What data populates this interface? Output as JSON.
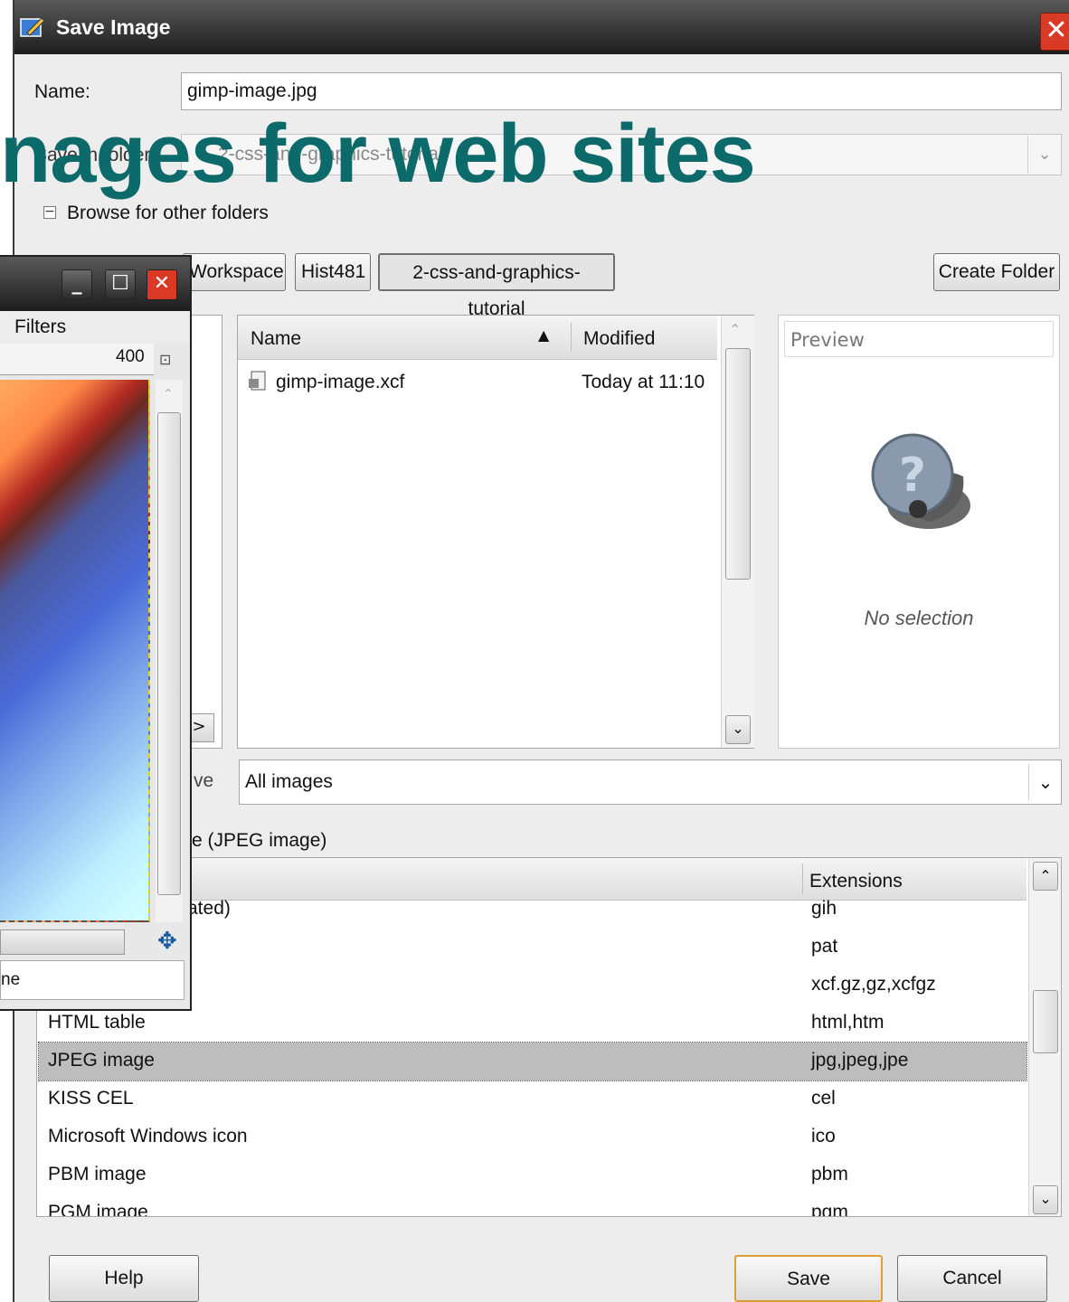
{
  "dialog": {
    "title": "Save Image",
    "close_glyph": "✕",
    "name_label": "Name:",
    "name_value": "gimp-image.jpg",
    "folder_label": "Save in folder:",
    "folder_value": "2-css-and-graphics-tutorial",
    "browse_label": "Browse for other folders",
    "expander_glyph": "−",
    "path_buttons": [
      "Workspace",
      "Hist481",
      "2-css-and-graphics-tutorial"
    ],
    "create_folder": "Create Folder",
    "places": {
      "scroll_right": ">"
    },
    "files": {
      "col_name": "Name",
      "col_modified": "Modified",
      "sort_glyph": "▲",
      "rows": [
        {
          "name": "gimp-image.xcf",
          "modified": "Today at 11:10"
        }
      ]
    },
    "preview": {
      "label": "Preview",
      "no_selection": "No selection"
    },
    "filter_value": "All images",
    "places_remove_fragment": "ve",
    "file_type_label": "e (JPEG image)",
    "types": {
      "col_ext": "Extensions",
      "partial_row_name": "ated)",
      "rows": [
        {
          "name": "",
          "ext": "gih"
        },
        {
          "name": "",
          "ext": "pat"
        },
        {
          "name": "",
          "ext": "xcf.gz,gz,xcfgz"
        },
        {
          "name": "HTML table",
          "ext": "html,htm"
        },
        {
          "name": "JPEG image",
          "ext": "jpg,jpeg,jpe"
        },
        {
          "name": "KISS CEL",
          "ext": "cel"
        },
        {
          "name": "Microsoft Windows icon",
          "ext": "ico"
        },
        {
          "name": "PBM image",
          "ext": "pbm"
        },
        {
          "name": "PGM image",
          "ext": "pgm"
        }
      ],
      "selected_index": 4
    },
    "buttons": {
      "help": "Help",
      "save": "Save",
      "cancel": "Cancel"
    }
  },
  "gimp_window": {
    "menu": "Filters",
    "ruler_tick": "400",
    "status_fragment": "ne",
    "minimize_glyph": "_",
    "maximize_glyph": "☐",
    "close_glyph": "✕",
    "nav_glyph": "✥"
  },
  "slide": {
    "title": "nages for web sites"
  },
  "colors": {
    "slide_title": "#0d6a6a",
    "close_red": "#d93a25",
    "save_border": "#e0a030"
  }
}
